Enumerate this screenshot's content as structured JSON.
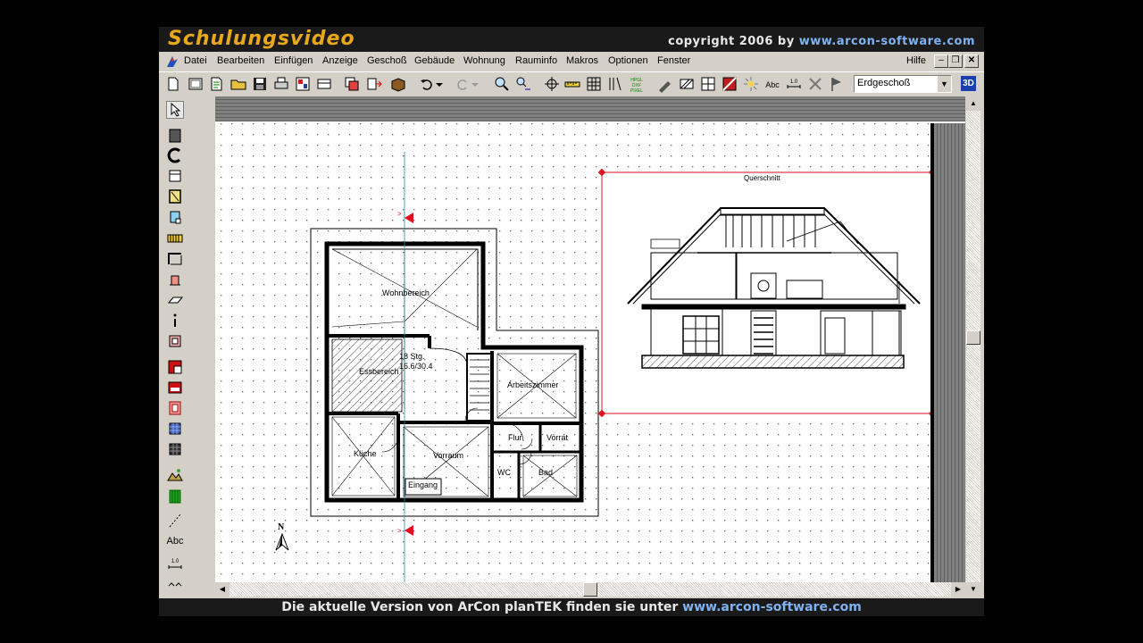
{
  "banner": {
    "title": "Schulungsvideo",
    "copyright": "copyright 2006 by",
    "url": "www.arcon-software.com"
  },
  "menu": {
    "items": [
      "Datei",
      "Bearbeiten",
      "Einfügen",
      "Anzeige",
      "Geschoß",
      "Gebäude",
      "Wohnung",
      "Rauminfo",
      "Makros",
      "Optionen",
      "Fenster"
    ],
    "help": "Hilfe"
  },
  "toolbar": {
    "floor_selected": "Erdgeschoß",
    "view3d_label": "3D"
  },
  "left_toolbar": {
    "text_tool_label": "Abc"
  },
  "plan": {
    "rooms": {
      "wohnbereich": "Wohnbereich",
      "essbereich": "Essbereich",
      "stairs_count": "18 Stg.",
      "stairs_dims": "16.6/30.4",
      "arbeitszimmer": "Arbeitszimmer",
      "kueche": "Küche",
      "vorraum": "Vorraum",
      "flur": "Flur",
      "vorrat": "Vorrat",
      "wc": "WC",
      "bad": "Bad",
      "eingang": "Eingang"
    },
    "north_label": "N",
    "section_title": "Querschnitt"
  },
  "footer": {
    "text": "Die aktuelle Version von ArCon planTEK finden sie unter",
    "url": "www.arcon-software.com"
  },
  "colors": {
    "banner_bg": "#1a1a1a",
    "banner_title": "#e8a81c",
    "url": "#7fb2f0",
    "selection": "#e01020",
    "window_bg": "#d4d0c8"
  }
}
